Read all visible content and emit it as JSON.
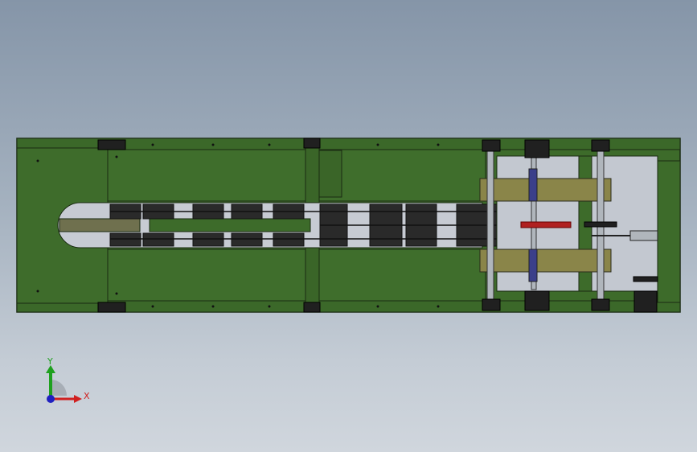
{
  "viewport": {
    "background_top": "#8595a8",
    "background_bottom": "#d0d6dd"
  },
  "model": {
    "body_color": "#3d6b2a",
    "body_edge_color": "#1a2a12",
    "track_color": "#c7cbd3",
    "slider_color": "#6f704e",
    "cylinder_color": "#8a8549",
    "rod_color": "#b0b6bc",
    "gear_color": "#202020",
    "red_part_color": "#b02020",
    "blue_part_color": "#3b3f8a"
  },
  "triad": {
    "x_label": "X",
    "y_label": "Y",
    "x_color": "#d02020",
    "y_color": "#1ea01e",
    "z_color": "#2020c0"
  }
}
